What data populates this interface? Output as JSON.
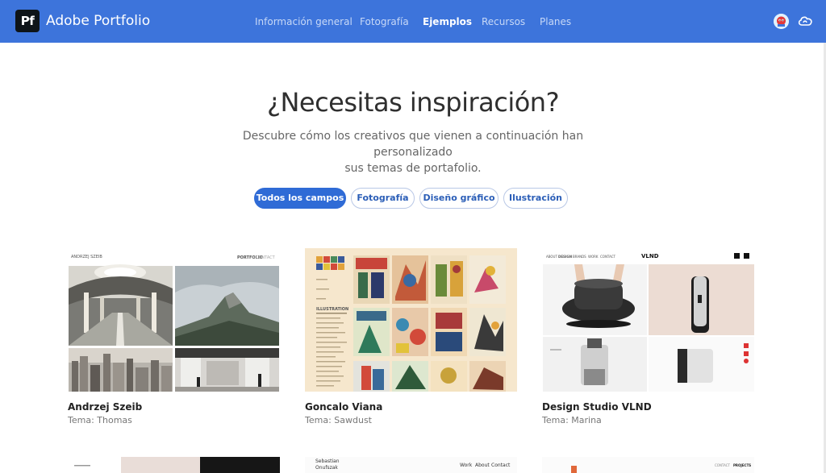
{
  "header": {
    "logo_text": "Pf",
    "brand": "Adobe Portfolio",
    "nav": [
      {
        "label": "Información general",
        "active": false
      },
      {
        "label": "Fotografía",
        "active": false
      },
      {
        "label": "Ejemplos",
        "active": true
      },
      {
        "label": "Recursos",
        "active": false
      },
      {
        "label": "Planes",
        "active": false
      }
    ],
    "icons": [
      "user-avatar-icon",
      "creative-cloud-icon"
    ]
  },
  "hero": {
    "title": "¿Necesitas inspiración?",
    "subtitle_line1": "Descubre cómo los creativos que vienen a continuación han personalizado",
    "subtitle_line2": "sus temas de portafolio."
  },
  "filters": [
    {
      "label": "Todos los campos",
      "active": true
    },
    {
      "label": "Fotografía",
      "active": false
    },
    {
      "label": "Diseño gráfico",
      "active": false
    },
    {
      "label": "Ilustración",
      "active": false
    }
  ],
  "cards": [
    {
      "name": "Andrzej Szeib",
      "theme": "Tema: Thomas",
      "thumb_header": "ANDRZEJ SZEIB",
      "thumb_nav": [
        "PORTFOLIO",
        "CONTACT"
      ]
    },
    {
      "name": "Goncalo Viana",
      "theme": "Tema: Sawdust",
      "thumb_heading": "ILLUSTRATION"
    },
    {
      "name": "Design Studio VLND",
      "theme": "Tema: Marina",
      "thumb_logo": "VLND",
      "thumb_nav": [
        "ABOUT",
        "DESIGN",
        "BRANDS",
        "WORK",
        "CONTACT"
      ]
    }
  ],
  "partial_cards": [
    {
      "text": ""
    },
    {
      "name_line1": "Sebastian",
      "name_line2": "Onufszak",
      "nav": [
        "Work",
        "About",
        "Contact"
      ]
    },
    {
      "nav": [
        "CONTACT",
        "PROJECTS"
      ]
    }
  ],
  "colors": {
    "header_bg": "#3d74db",
    "accent": "#2f6bd6"
  }
}
